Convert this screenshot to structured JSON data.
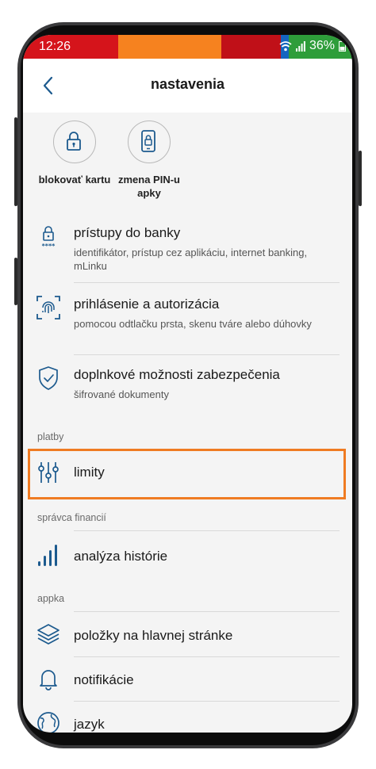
{
  "status_bar": {
    "time": "12:26",
    "battery": "36%"
  },
  "header": {
    "title": "nastavenia"
  },
  "quick_actions": [
    {
      "label": "blokovať kartu",
      "icon": "lock-icon"
    },
    {
      "label": "zmena PIN-u apky",
      "icon": "phone-lock-icon"
    }
  ],
  "security": [
    {
      "title": "prístupy do banky",
      "subtitle": "identifikátor, prístup cez aplikáciu, internet banking, mLinku",
      "icon": "lock-pin-icon"
    },
    {
      "title": "prihlásenie a autorizácia",
      "subtitle": "pomocou odtlačku prsta, skenu tváre alebo dúhovky",
      "icon": "fingerprint-icon"
    },
    {
      "title": "doplnkové možnosti zabezpečenia",
      "subtitle": "šifrované dokumenty",
      "icon": "shield-check-icon"
    }
  ],
  "sections": {
    "platby": "platby",
    "financie": "správca financií",
    "appka": "appka"
  },
  "limits": {
    "title": "limity",
    "icon": "sliders-icon"
  },
  "history": {
    "title": "analýza histórie",
    "icon": "bars-icon"
  },
  "appka_items": [
    {
      "title": "položky na hlavnej stránke",
      "icon": "layers-icon"
    },
    {
      "title": "notifikácie",
      "icon": "bell-icon"
    },
    {
      "title": "jazyk",
      "icon": "globe-icon"
    }
  ],
  "colors": {
    "accent": "#1c5a8e",
    "highlight": "#ef7b22",
    "background": "#f4f4f4"
  }
}
